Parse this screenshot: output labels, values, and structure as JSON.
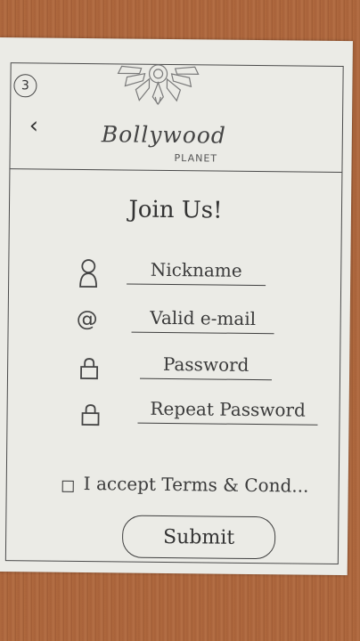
{
  "header": {
    "step_number": "3",
    "back_symbol": "‹",
    "brand_name": "Bollywood",
    "brand_sub": "PLANET"
  },
  "form": {
    "title": "Join Us!",
    "fields": [
      {
        "label": "Nickname",
        "icon": "person-icon"
      },
      {
        "label": "Valid e-mail",
        "icon": "at-icon"
      },
      {
        "label": "Password",
        "icon": "lock-icon"
      },
      {
        "label": "Repeat Password",
        "icon": "lock-icon"
      }
    ],
    "terms_label": "I accept Terms & Cond...",
    "submit_label": "Submit"
  }
}
